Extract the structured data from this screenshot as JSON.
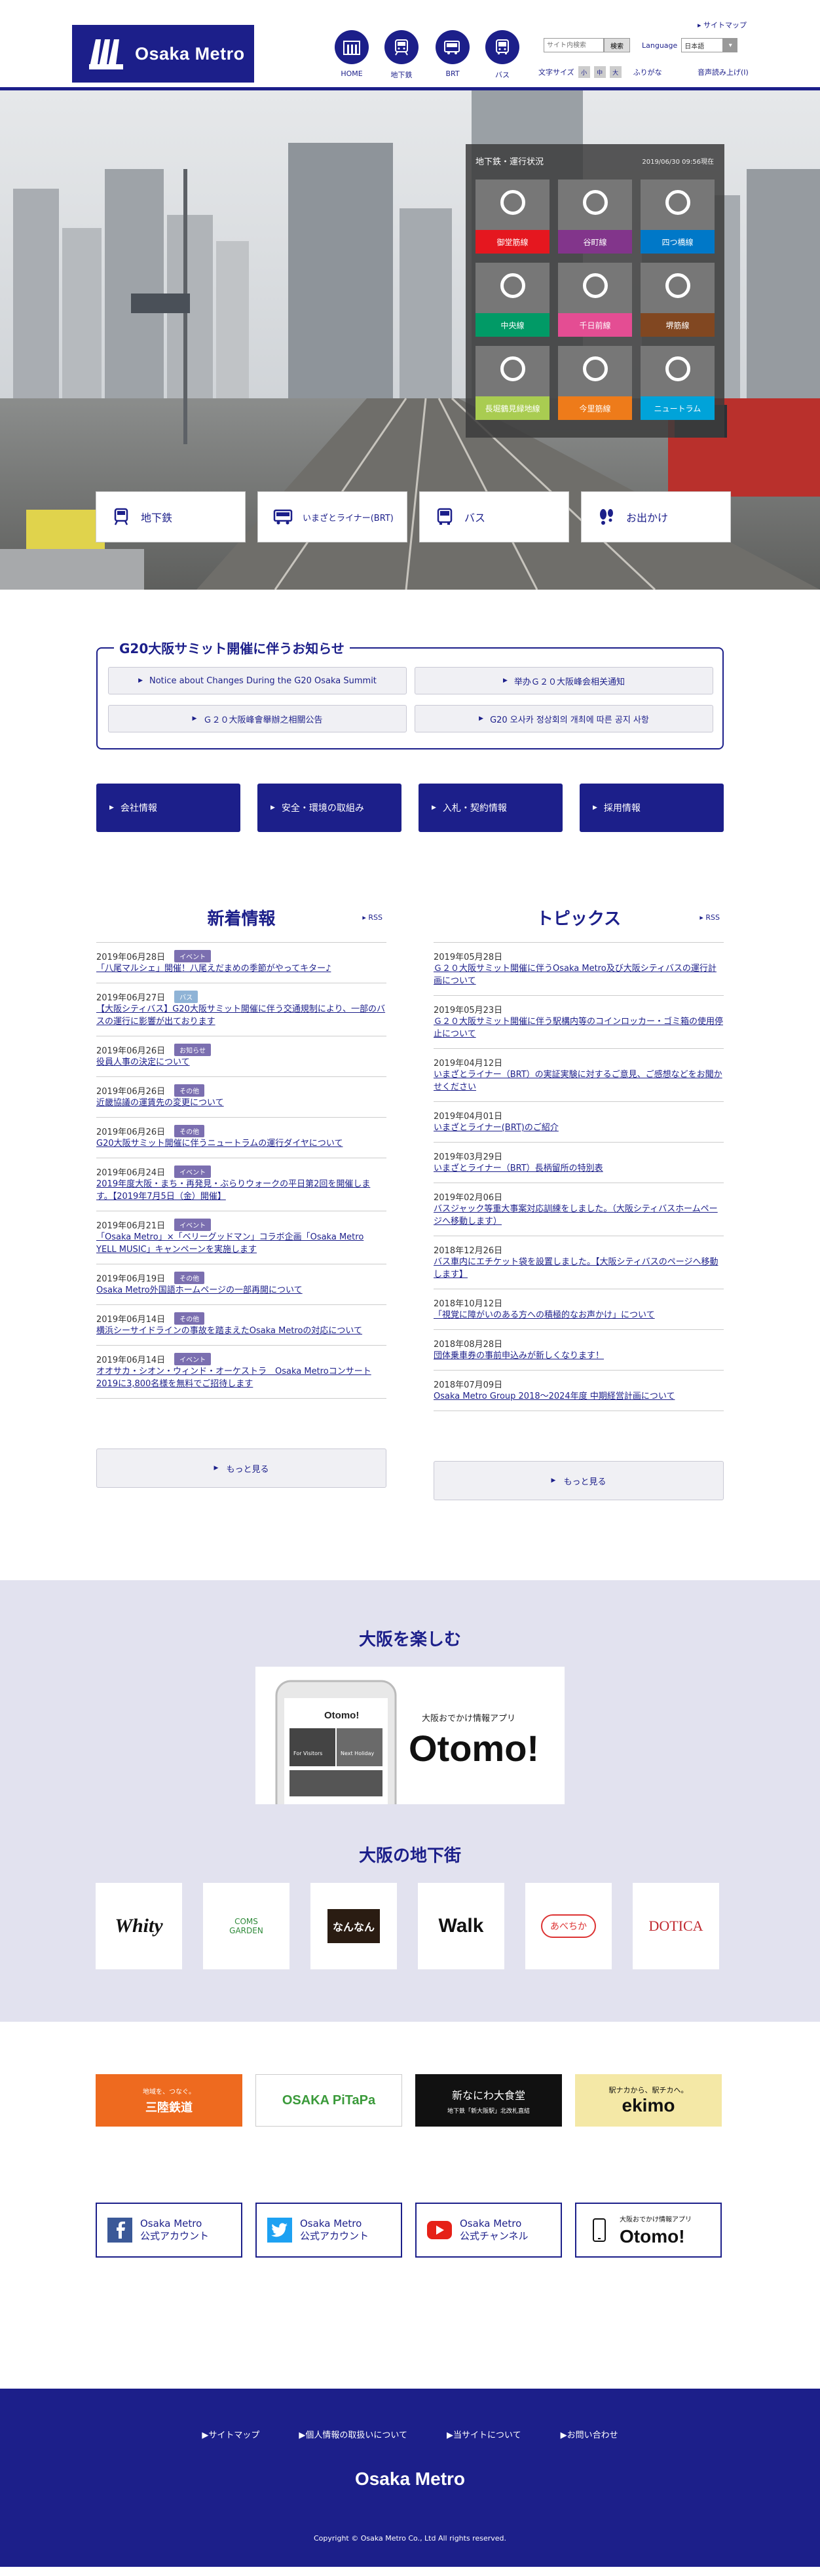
{
  "header": {
    "logo_text": "Osaka Metro",
    "sitemap": "▸ サイトマップ",
    "nav": [
      {
        "label": "HOME",
        "icon": "building-icon"
      },
      {
        "label": "地下鉄",
        "icon": "subway-icon"
      },
      {
        "label": "BRT",
        "icon": "brt-bus-icon"
      },
      {
        "label": "バス",
        "icon": "bus-icon"
      }
    ],
    "search_placeholder": "サイト内検索",
    "search_button": "検索",
    "language_label": "Language",
    "language_value": "日本語",
    "fontsize_label": "文字サイズ",
    "fontsize_buttons": [
      "小",
      "中",
      "大"
    ],
    "furigana": "ふりがな",
    "voice": "音声読み上げ(I)"
  },
  "status": {
    "title": "地下鉄・運行状況",
    "timestamp": "2019/06/30 09:56現在",
    "lines": [
      {
        "name": "御堂筋線",
        "color": "#e5171f"
      },
      {
        "name": "谷町線",
        "color": "#82358b"
      },
      {
        "name": "四つ橋線",
        "color": "#0078c8"
      },
      {
        "name": "中央線",
        "color": "#019a66"
      },
      {
        "name": "千日前線",
        "color": "#e44d93"
      },
      {
        "name": "堺筋線",
        "color": "#814721"
      },
      {
        "name": "長堀鶴見緑地線",
        "color": "#a9cc51"
      },
      {
        "name": "今里筋線",
        "color": "#ee7b1a"
      },
      {
        "name": "ニュートラム",
        "color": "#00a3d9"
      }
    ]
  },
  "modes": [
    {
      "label": "地下鉄",
      "icon": "subway-icon"
    },
    {
      "label": "いまざとライナー(BRT)",
      "icon": "brt-bus-icon"
    },
    {
      "label": "バス",
      "icon": "bus-icon"
    },
    {
      "label": "お出かけ",
      "icon": "footprints-icon"
    }
  ],
  "notice": {
    "title": "G20大阪サミット開催に伴うお知らせ",
    "items": [
      "Notice about Changes During the G20 Osaka Summit",
      "举办Ｇ２０大阪峰会相关通知",
      "Ｇ２０大阪峰會舉辦之相關公告",
      "G20 오사카 정상회의 개최에 따른 공지 사항"
    ]
  },
  "blue_buttons": [
    "会社情報",
    "安全・環境の取組み",
    "入札・契約情報",
    "採用情報"
  ],
  "news": {
    "title": "新着情報",
    "rss": "RSS",
    "more": "もっと見る",
    "items": [
      {
        "date": "2019年06月28日",
        "tag": "イベント",
        "text": "「八尾マルシェ」開催！八尾えだまめの季節がやってキター♪"
      },
      {
        "date": "2019年06月27日",
        "tag": "バス",
        "text": "【大阪シティバス】G20大阪サミット開催に伴う交通規制により、一部のバスの運行に影響が出ております"
      },
      {
        "date": "2019年06月26日",
        "tag": "お知らせ",
        "text": "役員人事の決定について"
      },
      {
        "date": "2019年06月26日",
        "tag": "その他",
        "text": "近畿協議の運賃先の変更について"
      },
      {
        "date": "2019年06月26日",
        "tag": "その他",
        "text": "G20大阪サミット開催に伴うニュートラムの運行ダイヤについて"
      },
      {
        "date": "2019年06月24日",
        "tag": "イベント",
        "text": "2019年度大阪・まち・再発見・ぶらりウォークの平日第2回を開催します。【2019年7月5日（金）開催】"
      },
      {
        "date": "2019年06月21日",
        "tag": "イベント",
        "text": "「Osaka Metro」×「ベリーグッドマン」コラボ企画「Osaka Metro YELL MUSIC」キャンペーンを実施します"
      },
      {
        "date": "2019年06月19日",
        "tag": "その他",
        "text": "Osaka Metro外国語ホームページの一部再開について"
      },
      {
        "date": "2019年06月14日",
        "tag": "その他",
        "text": "横浜シーサイドラインの事故を踏まえたOsaka Metroの対応について"
      },
      {
        "date": "2019年06月14日",
        "tag": "イベント",
        "text": "オオサカ・シオン・ウィンド・オーケストラ　Osaka Metroコンサート2019に3,800名様を無料でご招待します"
      }
    ]
  },
  "topics": {
    "title": "トピックス",
    "rss": "RSS",
    "more": "もっと見る",
    "items": [
      {
        "date": "2019年05月28日",
        "text": "Ｇ２０大阪サミット開催に伴うOsaka Metro及び大阪シティバスの運行計画について"
      },
      {
        "date": "2019年05月23日",
        "text": "Ｇ２０大阪サミット開催に伴う駅構内等のコインロッカー・ゴミ箱の使用停止について"
      },
      {
        "date": "2019年04月12日",
        "text": "いまざとライナー（BRT）の実証実験に対するご意見、ご感想などをお聞かせください"
      },
      {
        "date": "2019年04月01日",
        "text": "いまざとライナー(BRT)のご紹介"
      },
      {
        "date": "2019年03月29日",
        "text": "いまざとライナー（BRT）長柄留所の特別表"
      },
      {
        "date": "2019年02月06日",
        "text": "バスジャック等重大事案対応訓練をしました。（大阪シティバスホームページへ移動します）"
      },
      {
        "date": "2018年12月26日",
        "text": "バス車内にエチケット袋を設置しました。【大阪シティバスのページへ移動します】"
      },
      {
        "date": "2018年10月12日",
        "text": "「視覚に障がいのある方への積極的なお声かけ」について"
      },
      {
        "date": "2018年08月28日",
        "text": "団体乗車券の事前申込みが新しくなります！"
      },
      {
        "date": "2018年07月09日",
        "text": "Osaka Metro Group 2018～2024年度 中期経営計画について"
      }
    ]
  },
  "enjoy": {
    "title": "大阪を楽しむ",
    "otomo_caption": "大阪おでかけ情報アプリ",
    "otomo_name": "Otomo!",
    "phone_header": "Otomo!",
    "phone_tabs": [
      "For Visitors",
      "Next Holiday"
    ],
    "underground_title": "大阪の地下街",
    "malls": [
      "Whity",
      "COMS GARDEN",
      "なんなん",
      "Walk",
      "あべちか",
      "DOTICA"
    ]
  },
  "banners": {
    "sanyo": "三陸鉄道",
    "sanyo_sub": "地域を、つなぐ。",
    "pitapa": "OSAKA PiTaPa",
    "nanimaru": "新なにわ大食堂",
    "nanimaru_sub": "地下鉄「新大阪駅」北改札直結",
    "ekimo": "ekimo",
    "ekimo_sub": "駅ナカから、駅チカへ。"
  },
  "social": [
    {
      "line1": "Osaka Metro",
      "line2": "公式アカウント",
      "icon": "facebook-icon"
    },
    {
      "line1": "Osaka Metro",
      "line2": "公式アカウント",
      "icon": "twitter-icon"
    },
    {
      "line1": "Osaka Metro",
      "line2": "公式チャンネル",
      "icon": "youtube-icon"
    },
    {
      "line1": "大阪おでかけ情報アプリ",
      "line2": "Otomo!",
      "icon": "smartphone-icon"
    }
  ],
  "footer": {
    "links": [
      "サイトマップ",
      "個人情報の取扱いについて",
      "当サイトについて",
      "お問い合わせ"
    ],
    "logo": "Osaka Metro",
    "copyright": "Copyright © Osaka Metro Co., Ltd All rights reserved."
  }
}
